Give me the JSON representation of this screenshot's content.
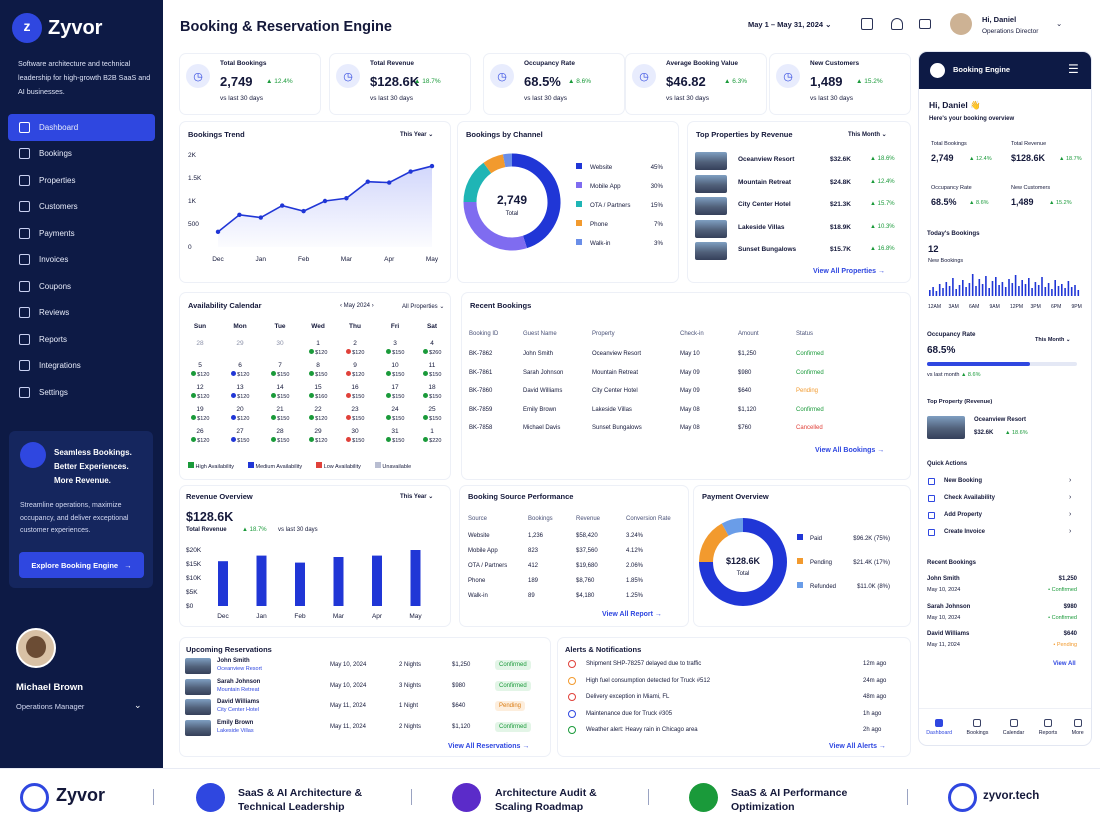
{
  "brand": {
    "name": "Zyvor",
    "tagline": "Software architecture and technical leadership for high-growth B2B SaaS and AI businesses."
  },
  "nav": [
    {
      "label": "Dashboard",
      "active": true
    },
    {
      "label": "Bookings"
    },
    {
      "label": "Properties"
    },
    {
      "label": "Customers"
    },
    {
      "label": "Payments"
    },
    {
      "label": "Invoices"
    },
    {
      "label": "Coupons"
    },
    {
      "label": "Reviews"
    },
    {
      "label": "Reports"
    },
    {
      "label": "Integrations"
    },
    {
      "label": "Settings"
    }
  ],
  "promo": {
    "heading": "Seamless Bookings. Better Experiences. More Revenue.",
    "text": "Streamline operations, maximize occupancy, and deliver exceptional customer experiences.",
    "button": "Explore Booking Engine"
  },
  "sidebar_user": {
    "name": "Michael Brown",
    "role": "Operations Manager"
  },
  "header": {
    "title": "Booking & Reservation Engine",
    "date_range": "May 1 – May 31, 2024",
    "user_greeting": "Hi, Daniel",
    "user_role": "Operations Director"
  },
  "kpis": [
    {
      "label": "Total Bookings",
      "value": "2,749",
      "delta": "12.4%",
      "sub": "vs last 30 days",
      "icon": "calendar-icon"
    },
    {
      "label": "Total Revenue",
      "value": "$128.6K",
      "delta": "18.7%",
      "sub": "vs last 30 days",
      "icon": "dollar-icon"
    },
    {
      "label": "Occupancy Rate",
      "value": "68.5%",
      "delta": "8.6%",
      "sub": "vs last 30 days",
      "icon": "clock-icon"
    },
    {
      "label": "Average Booking Value",
      "value": "$46.82",
      "delta": "6.3%",
      "sub": "vs last 30 days",
      "icon": "bar-chart-icon"
    },
    {
      "label": "New Customers",
      "value": "1,489",
      "delta": "15.2%",
      "sub": "vs last 30 days",
      "icon": "user-icon"
    }
  ],
  "trend": {
    "title": "Bookings Trend",
    "period": "This Year"
  },
  "chart_data": [
    {
      "type": "line",
      "title": "Bookings Trend",
      "x": [
        "Dec",
        "",
        "Jan",
        "",
        "Feb",
        "",
        "Mar",
        "",
        "Apr",
        "",
        "May"
      ],
      "values": [
        330,
        700,
        640,
        900,
        780,
        1000,
        1060,
        1420,
        1400,
        1640,
        1760
      ],
      "yticks": [
        "2K",
        "1.5K",
        "1K",
        "500",
        "0"
      ],
      "ylim": [
        0,
        2000
      ],
      "grid": false
    },
    {
      "type": "pie",
      "title": "Bookings by Channel",
      "center_value": "2,749",
      "center_label": "Total",
      "categories": [
        "Website",
        "Mobile App",
        "OTA / Partners",
        "Phone",
        "Walk-in"
      ],
      "values": [
        45,
        30,
        15,
        7,
        3
      ],
      "labels": [
        "45%",
        "30%",
        "15%",
        "7%",
        "3%"
      ],
      "colors": [
        "#2036d6",
        "#7f6cf0",
        "#1fb5b5",
        "#f29a2e",
        "#6a8ee8"
      ]
    },
    {
      "type": "bar",
      "title": "Revenue Overview",
      "categories": [
        "Dec",
        "Jan",
        "Feb",
        "Mar",
        "Apr",
        "May"
      ],
      "values": [
        16,
        18,
        15.5,
        17.5,
        18,
        20
      ],
      "yticks": [
        "$20K",
        "$15K",
        "$10K",
        "$5K",
        "$0"
      ],
      "ylim": [
        0,
        20
      ]
    },
    {
      "type": "pie",
      "title": "Payment Overview",
      "center_value": "$128.6K",
      "center_label": "Total",
      "categories": [
        "Paid",
        "Pending",
        "Refunded"
      ],
      "values": [
        75,
        17,
        8
      ],
      "labels": [
        "$96.2K (75%)",
        "$21.4K (17%)",
        "$11.0K (8%)"
      ],
      "colors": [
        "#2036d6",
        "#f29a2e",
        "#6a9de8"
      ]
    }
  ],
  "channel": {
    "title": "Bookings by Channel"
  },
  "top_props": {
    "title": "Top Properties by Revenue",
    "period": "This Month",
    "link": "View All Properties",
    "rows": [
      {
        "name": "Oceanview Resort",
        "value": "$32.6K",
        "delta": "18.6%"
      },
      {
        "name": "Mountain Retreat",
        "value": "$24.8K",
        "delta": "12.4%"
      },
      {
        "name": "City Center Hotel",
        "value": "$21.3K",
        "delta": "15.7%"
      },
      {
        "name": "Lakeside Villas",
        "value": "$18.9K",
        "delta": "10.3%"
      },
      {
        "name": "Sunset Bungalows",
        "value": "$15.7K",
        "delta": "16.8%"
      }
    ]
  },
  "calendar": {
    "title": "Availability Calendar",
    "month": "May 2024",
    "filter": "All Properties",
    "days": [
      "Sun",
      "Mon",
      "Tue",
      "Wed",
      "Thu",
      "Fri",
      "Sat"
    ],
    "cells": [
      [
        "28",
        ""
      ],
      [
        "29",
        ""
      ],
      [
        "30",
        ""
      ],
      [
        "1",
        "$120"
      ],
      [
        "2",
        "$120"
      ],
      [
        "3",
        "$150"
      ],
      [
        "4",
        "$260"
      ],
      [
        "5",
        "$120"
      ],
      [
        "6",
        "$120"
      ],
      [
        "7",
        "$150"
      ],
      [
        "8",
        "$150"
      ],
      [
        "9",
        "$120"
      ],
      [
        "10",
        "$150"
      ],
      [
        "11",
        "$150"
      ],
      [
        "12",
        "$120"
      ],
      [
        "13",
        "$120"
      ],
      [
        "14",
        "$150"
      ],
      [
        "15",
        "$160"
      ],
      [
        "16",
        "$150"
      ],
      [
        "17",
        "$150"
      ],
      [
        "18",
        "$150"
      ],
      [
        "19",
        "$120"
      ],
      [
        "20",
        "$120"
      ],
      [
        "21",
        "$150"
      ],
      [
        "22",
        "$120"
      ],
      [
        "23",
        "$150"
      ],
      [
        "24",
        "$150"
      ],
      [
        "25",
        "$150"
      ],
      [
        "26",
        "$120"
      ],
      [
        "27",
        "$150"
      ],
      [
        "28",
        "$150"
      ],
      [
        "29",
        "$120"
      ],
      [
        "30",
        "$150"
      ],
      [
        "31",
        "$150"
      ],
      [
        "1",
        "$220"
      ]
    ],
    "legend": [
      "High Availability",
      "Medium Availability",
      "Low Availability",
      "Unavailable"
    ]
  },
  "recent": {
    "title": "Recent Bookings",
    "link": "View All Bookings",
    "cols": [
      "Booking ID",
      "Guest Name",
      "Property",
      "Check-in",
      "Amount",
      "Status"
    ],
    "rows": [
      [
        "BK-7862",
        "John Smith",
        "Oceanview Resort",
        "May 10",
        "$1,250",
        "Confirmed"
      ],
      [
        "BK-7861",
        "Sarah Johnson",
        "Mountain Retreat",
        "May 09",
        "$980",
        "Confirmed"
      ],
      [
        "BK-7860",
        "David Williams",
        "City Center Hotel",
        "May 09",
        "$640",
        "Pending"
      ],
      [
        "BK-7859",
        "Emily Brown",
        "Lakeside Villas",
        "May 08",
        "$1,120",
        "Confirmed"
      ],
      [
        "BK-7858",
        "Michael Davis",
        "Sunset Bungalows",
        "May 08",
        "$760",
        "Cancelled"
      ]
    ]
  },
  "revenue": {
    "title": "Revenue Overview",
    "period": "This Year",
    "value": "$128.6K",
    "label": "Total Revenue",
    "delta": "18.7%",
    "sub": "vs last 30 days"
  },
  "source": {
    "title": "Booking Source Performance",
    "link": "View All Report",
    "cols": [
      "Source",
      "Bookings",
      "Revenue",
      "Conversion Rate"
    ],
    "rows": [
      [
        "Website",
        "1,236",
        "$58,420",
        "3.24%"
      ],
      [
        "Mobile App",
        "823",
        "$37,560",
        "4.12%"
      ],
      [
        "OTA / Partners",
        "412",
        "$19,680",
        "2.06%"
      ],
      [
        "Phone",
        "189",
        "$8,760",
        "1.85%"
      ],
      [
        "Walk-in",
        "89",
        "$4,180",
        "1.25%"
      ]
    ]
  },
  "payment": {
    "title": "Payment Overview"
  },
  "upcoming": {
    "title": "Upcoming Reservations",
    "link": "View All Reservations",
    "rows": [
      {
        "name": "John Smith",
        "prop": "Oceanview Resort",
        "date": "May 10, 2024",
        "nights": "2 Nights",
        "amt": "$1,250",
        "status": "Confirmed"
      },
      {
        "name": "Sarah Johnson",
        "prop": "Mountain Retreat",
        "date": "May 10, 2024",
        "nights": "3 Nights",
        "amt": "$980",
        "status": "Confirmed"
      },
      {
        "name": "David Williams",
        "prop": "City Center Hotel",
        "date": "May 11, 2024",
        "nights": "1 Night",
        "amt": "$640",
        "status": "Pending"
      },
      {
        "name": "Emily Brown",
        "prop": "Lakeside Villas",
        "date": "May 11, 2024",
        "nights": "2 Nights",
        "amt": "$1,120",
        "status": "Confirmed"
      }
    ]
  },
  "alerts": {
    "title": "Alerts & Notifications",
    "link": "View All Alerts",
    "rows": [
      {
        "text": "Shipment SHP-78257 delayed due to traffic",
        "time": "12m ago",
        "color": "#e0413a"
      },
      {
        "text": "High fuel consumption detected for Truck #512",
        "time": "24m ago",
        "color": "#f29a2e"
      },
      {
        "text": "Delivery exception in Miami, FL",
        "time": "48m ago",
        "color": "#e0413a"
      },
      {
        "text": "Maintenance due for Truck #305",
        "time": "1h ago",
        "color": "#2f47e0"
      },
      {
        "text": "Weather alert: Heavy rain in Chicago area",
        "time": "2h ago",
        "color": "#1a9a3a"
      }
    ]
  },
  "mobile": {
    "title": "Booking Engine",
    "greeting": "Hi, Daniel 👋",
    "sub": "Here's your booking overview",
    "kpis": [
      {
        "label": "Total Bookings",
        "value": "2,749",
        "delta": "12.4%"
      },
      {
        "label": "Total Revenue",
        "value": "$128.6K",
        "delta": "18.7%"
      },
      {
        "label": "Occupancy Rate",
        "value": "68.5%",
        "delta": "8.6%"
      },
      {
        "label": "New Customers",
        "value": "1,489",
        "delta": "15.2%"
      }
    ],
    "today_title": "Today's Bookings",
    "today_value": "12",
    "today_label": "New Bookings",
    "today_ticks": [
      "12AM",
      "3AM",
      "6AM",
      "9AM",
      "12PM",
      "3PM",
      "6PM",
      "9PM"
    ],
    "occ_title": "Occupancy Rate",
    "occ_period": "This Month",
    "occ_value": "68.5%",
    "occ_fill": 0.685,
    "occ_sub": "vs last month",
    "occ_delta": "8.6%",
    "top_title": "Top Property (Revenue)",
    "top_name": "Oceanview Resort",
    "top_value": "$32.6K",
    "top_delta": "18.6%",
    "qa_title": "Quick Actions",
    "qa": [
      "New Booking",
      "Check Availability",
      "Add Property",
      "Create Invoice"
    ],
    "rb_title": "Recent Bookings",
    "rb": [
      {
        "name": "John Smith",
        "date": "May 10, 2024",
        "amt": "$1,250",
        "status": "Confirmed"
      },
      {
        "name": "Sarah Johnson",
        "date": "May 10, 2024",
        "amt": "$980",
        "status": "Confirmed"
      },
      {
        "name": "David Williams",
        "date": "May 11, 2024",
        "amt": "$640",
        "status": "Pending"
      }
    ],
    "view_all": "View All",
    "tabs": [
      "Dashboard",
      "Bookings",
      "Calendar",
      "Reports",
      "More"
    ]
  },
  "footer": {
    "brand": "Zyvor",
    "items": [
      "SaaS & AI Architecture & Technical Leadership",
      "Architecture Audit & Scaling Roadmap",
      "SaaS & AI Performance Optimization"
    ],
    "url": "zyvor.tech"
  }
}
